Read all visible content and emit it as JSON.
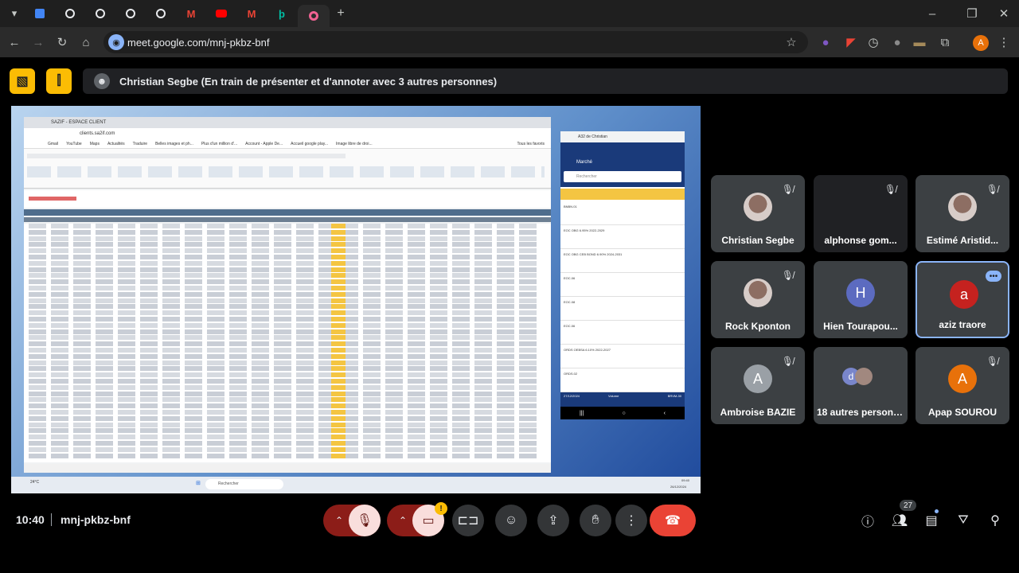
{
  "browser": {
    "address": "meet.google.com/mnj-pkbz-bnf",
    "profile_initial": "A",
    "new_tab": "+"
  },
  "banner": {
    "presenter_text": "Christian Segbe (En train de présenter et d'annoter avec 3 autres personnes)"
  },
  "shared_screen": {
    "window_title": "SAZIF - ESPACE CLIENT",
    "url": "clients.sa2if.com",
    "bookmarks": [
      "Gmail",
      "YouTube",
      "Maps",
      "Actualités",
      "Traduire",
      "Belles images et ph...",
      "Plus d'un million d'...",
      "Account - Apple De...",
      "Accueil google play...",
      "Image libre de droi..."
    ],
    "all_favorites": "Tous les favoris",
    "phone_title": "A32 de Christian",
    "phone_header": "Marché",
    "phone_search": "Rechercher",
    "phone_bottom_left": "27/12/2024",
    "phone_bottom_right": "BRVM-30",
    "phone_volume": "Volume",
    "phone_items": [
      "BNBN.01",
      "EOC OBG 6.95% 2022-2029",
      "EOC OBG CEB BOND 6.90% 2024-2031",
      "EOC.06",
      "EOC.08",
      "EOC.06",
      "ORDS OEBSA 6.10% 2022-2027",
      "ORDS.02"
    ],
    "taskbar_weather": "24°C",
    "taskbar_search": "Rechercher",
    "taskbar_time": "09:40",
    "taskbar_date": "26/12/2024"
  },
  "participants": [
    {
      "name": "Christian Segbe",
      "initial": "",
      "type": "photo",
      "muted": true
    },
    {
      "name": "alphonse gom...",
      "initial": "",
      "type": "blank",
      "muted": true
    },
    {
      "name": "Estimé Aristid...",
      "initial": "",
      "type": "photo",
      "muted": true
    },
    {
      "name": "Rock Kponton",
      "initial": "",
      "type": "photo",
      "muted": true
    },
    {
      "name": "Hien Tourapou...",
      "initial": "H",
      "type": "letter",
      "color": "#5c6bc0",
      "muted": false
    },
    {
      "name": "aziz traore",
      "initial": "a",
      "type": "letter",
      "color": "#c5221f",
      "muted": false,
      "active": true
    },
    {
      "name": "Ambroise BAZIE",
      "initial": "A",
      "type": "letter",
      "color": "#9aa0a6",
      "muted": true
    },
    {
      "name": "18 autres personnes",
      "initial": "d",
      "type": "group",
      "muted": false
    },
    {
      "name": "Apap SOUROU",
      "initial": "A",
      "type": "letter",
      "color": "#e8710a",
      "muted": true
    }
  ],
  "bottom_bar": {
    "time": "10:40",
    "meeting_code": "mnj-pkbz-bnf",
    "participant_count": "27",
    "camera_alert": "!"
  },
  "icons": {
    "back": "arrow-left-icon",
    "forward": "arrow-right-icon",
    "reload": "reload-icon",
    "home": "home-icon",
    "star": "star-icon",
    "extensions": "puzzle-icon",
    "menu": "kebab-menu-icon"
  },
  "colors": {
    "accent_yellow": "#fbbc04",
    "hangup_red": "#ea4335",
    "mic_off_bg": "#f9dedc",
    "active_tile_border": "#8ab4f8"
  }
}
